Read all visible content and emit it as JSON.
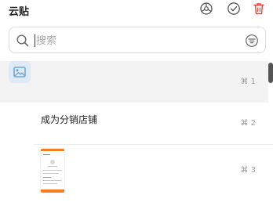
{
  "app": {
    "title": "云贴"
  },
  "search": {
    "placeholder": "搜索",
    "value": ""
  },
  "items": [
    {
      "type": "text",
      "label": "",
      "shortcut": "⌘ 1"
    },
    {
      "type": "text",
      "label": "成为分销店铺",
      "shortcut": "⌘ 2"
    },
    {
      "type": "image",
      "label": "",
      "shortcut": "⌘ 3"
    }
  ],
  "icons": {
    "settings": "settings-icon",
    "check": "check-circle-icon",
    "delete": "trash-icon",
    "search": "search-icon",
    "filter": "filter-icon",
    "text_item": "text-lines-icon",
    "image_item": "image-icon"
  },
  "colors": {
    "accent": "#5b9bd5",
    "delete": "#e8453c",
    "thumb_accent": "#f57c1f",
    "selected_row": "#f3f3f3"
  }
}
